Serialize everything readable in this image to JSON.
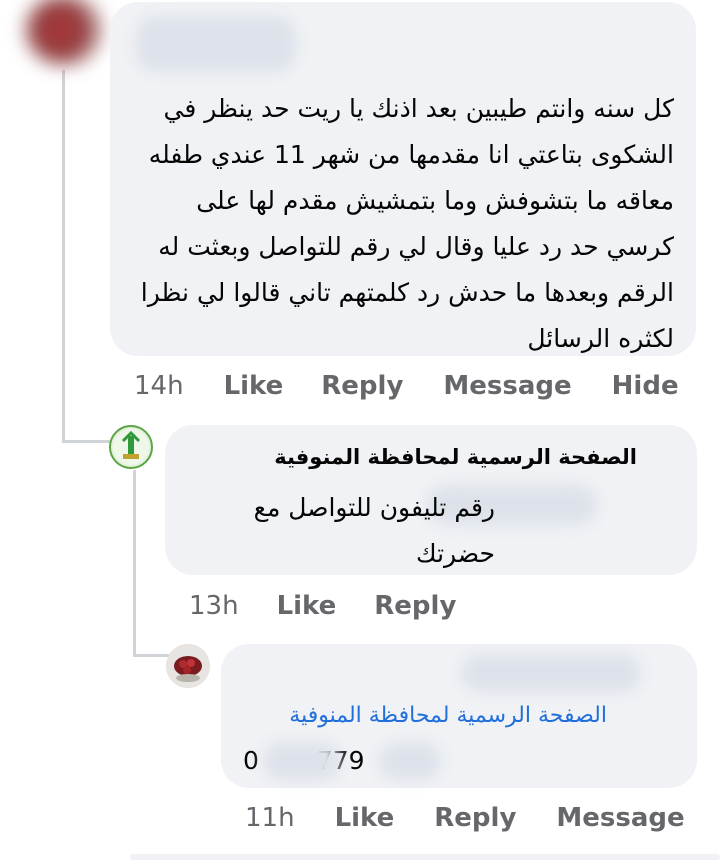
{
  "comments": [
    {
      "author": "",
      "text": "كل سنه وانتم طيبين بعد اذنك يا ريت حد ينظر في\nالشكوى بتاعتي انا مقدمها من شهر 11 عندي طفله\nمعاقه ما بتشوفش وما بتمشيش مقدم لها على\nكرسي حد رد عليا وقال لي رقم للتواصل وبعثت له\nالرقم وبعدها ما حدش رد كلمتهم تاني قالوا لي نظرا\nلكثره الرسائل",
      "time": "14h",
      "actions": [
        "Like",
        "Reply",
        "Message",
        "Hide"
      ]
    },
    {
      "author": "الصفحة الرسمية لمحافظة المنوفية",
      "text": "رقم تليفون للتواصل مع\nحضرتك",
      "time": "13h",
      "actions": [
        "Like",
        "Reply"
      ]
    },
    {
      "author": "",
      "mention": "الصفحة الرسمية لمحافظة المنوفية",
      "text": "0 779",
      "time": "11h",
      "actions": [
        "Like",
        "Reply",
        "Message"
      ]
    }
  ],
  "colors": {
    "bubble": "#f0f2f5",
    "link": "#216fdb",
    "meta": "#65676b",
    "logo": "#2f9a3b"
  },
  "icons": {
    "page_logo": "monument-logo-icon",
    "rose_avatar": "rose-avatar-icon"
  }
}
